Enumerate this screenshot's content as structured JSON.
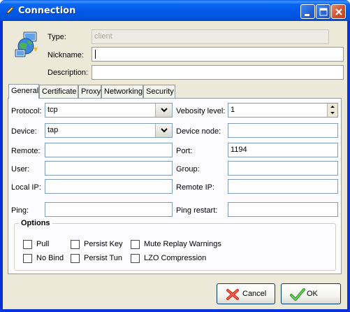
{
  "window": {
    "title": "Connection"
  },
  "header": {
    "type_label": "Type:",
    "type_value": "client",
    "nickname_label": "Nickname:",
    "nickname_value": "",
    "description_label": "Description:",
    "description_value": ""
  },
  "tabs": [
    {
      "label": "General"
    },
    {
      "label": "Certificate"
    },
    {
      "label": "Proxy"
    },
    {
      "label": "Networking"
    },
    {
      "label": "Security"
    }
  ],
  "general": {
    "protocol_label": "Protocol:",
    "protocol_value": "tcp",
    "verbosity_label": "Vebosity level:",
    "verbosity_value": "1",
    "device_label": "Device:",
    "device_value": "tap",
    "device_node_label": "Device node:",
    "device_node_value": "",
    "remote_label": "Remote:",
    "remote_value": "",
    "port_label": "Port:",
    "port_value": "1194",
    "user_label": "User:",
    "user_value": "",
    "group_label": "Group:",
    "group_value": "",
    "local_ip_label": "Local IP:",
    "local_ip_value": "",
    "remote_ip_label": "Remote IP:",
    "remote_ip_value": "",
    "ping_label": "Ping:",
    "ping_value": "",
    "ping_restart_label": "Ping restart:",
    "ping_restart_value": ""
  },
  "options": {
    "title": "Options",
    "items": [
      {
        "label": "Pull",
        "checked": false
      },
      {
        "label": "Persist Key",
        "checked": false
      },
      {
        "label": "Mute Replay Warnings",
        "checked": false
      },
      {
        "label": "No Bind",
        "checked": false
      },
      {
        "label": "Persist Tun",
        "checked": false
      },
      {
        "label": "LZO Compression",
        "checked": false
      }
    ]
  },
  "buttons": {
    "cancel": "Cancel",
    "ok": "OK"
  },
  "colors": {
    "titlebar": "#0058e6",
    "face": "#ece9d8",
    "panel": "#fcfcfe",
    "input_border": "#7f9db9"
  }
}
